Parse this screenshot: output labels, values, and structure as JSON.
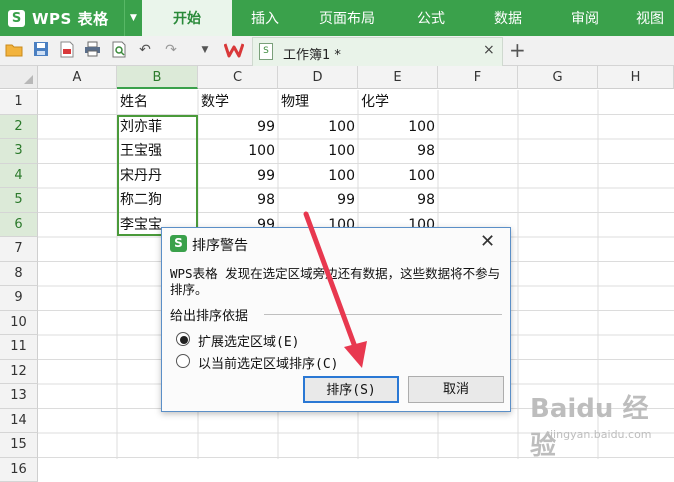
{
  "app": {
    "logo": "S",
    "title": "WPS 表格",
    "dropdown_icon": "triangle-down-icon"
  },
  "menu": [
    "开始",
    "插入",
    "页面布局",
    "公式",
    "数据",
    "审阅",
    "视图"
  ],
  "toolbar": {
    "icons": [
      "folder-open-icon",
      "save-icon",
      "export-pdf-icon",
      "print-icon",
      "print-preview-icon",
      "undo-icon",
      "redo-icon",
      "dropdown-icon"
    ],
    "doc_tab": {
      "name": "工作簿1 *",
      "close": "×"
    },
    "new_tab": "+"
  },
  "sheet": {
    "columns": [
      "A",
      "B",
      "C",
      "D",
      "E",
      "F",
      "G",
      "H"
    ],
    "selected_column": "B",
    "rows": [
      "1",
      "2",
      "3",
      "4",
      "5",
      "6",
      "7",
      "8",
      "9",
      "10",
      "11",
      "12",
      "13",
      "14",
      "15",
      "16"
    ],
    "selected_rows": [
      "2",
      "3",
      "4",
      "5",
      "6"
    ],
    "headers": [
      "姓名",
      "数学",
      "物理",
      "化学"
    ],
    "records": [
      [
        "刘亦菲",
        "99",
        "100",
        "100"
      ],
      [
        "王宝强",
        "100",
        "100",
        "98"
      ],
      [
        "宋丹丹",
        "99",
        "100",
        "100"
      ],
      [
        "称二狗",
        "98",
        "99",
        "98"
      ],
      [
        "李宝宝",
        "99",
        "100",
        "100"
      ]
    ]
  },
  "dialog": {
    "icon": "S",
    "title": "排序警告",
    "close": "✕",
    "message": "WPS表格 发现在选定区域旁边还有数据，这些数据将不参与排序。",
    "section": "给出排序依据",
    "options": [
      {
        "label": "扩展选定区域(E)",
        "selected": true
      },
      {
        "label": "以当前选定区域排序(C)",
        "selected": false
      }
    ],
    "buttons": {
      "sort": "排序(S)",
      "cancel": "取消"
    }
  },
  "watermark": {
    "main": "Baidu 经验",
    "sub": "jingyan.baidu.com"
  },
  "colors": {
    "accent": "#3aa14b",
    "selection": "#4a9a3a",
    "arrow": "#e8384f",
    "dialog_border": "#5b8fc7"
  }
}
